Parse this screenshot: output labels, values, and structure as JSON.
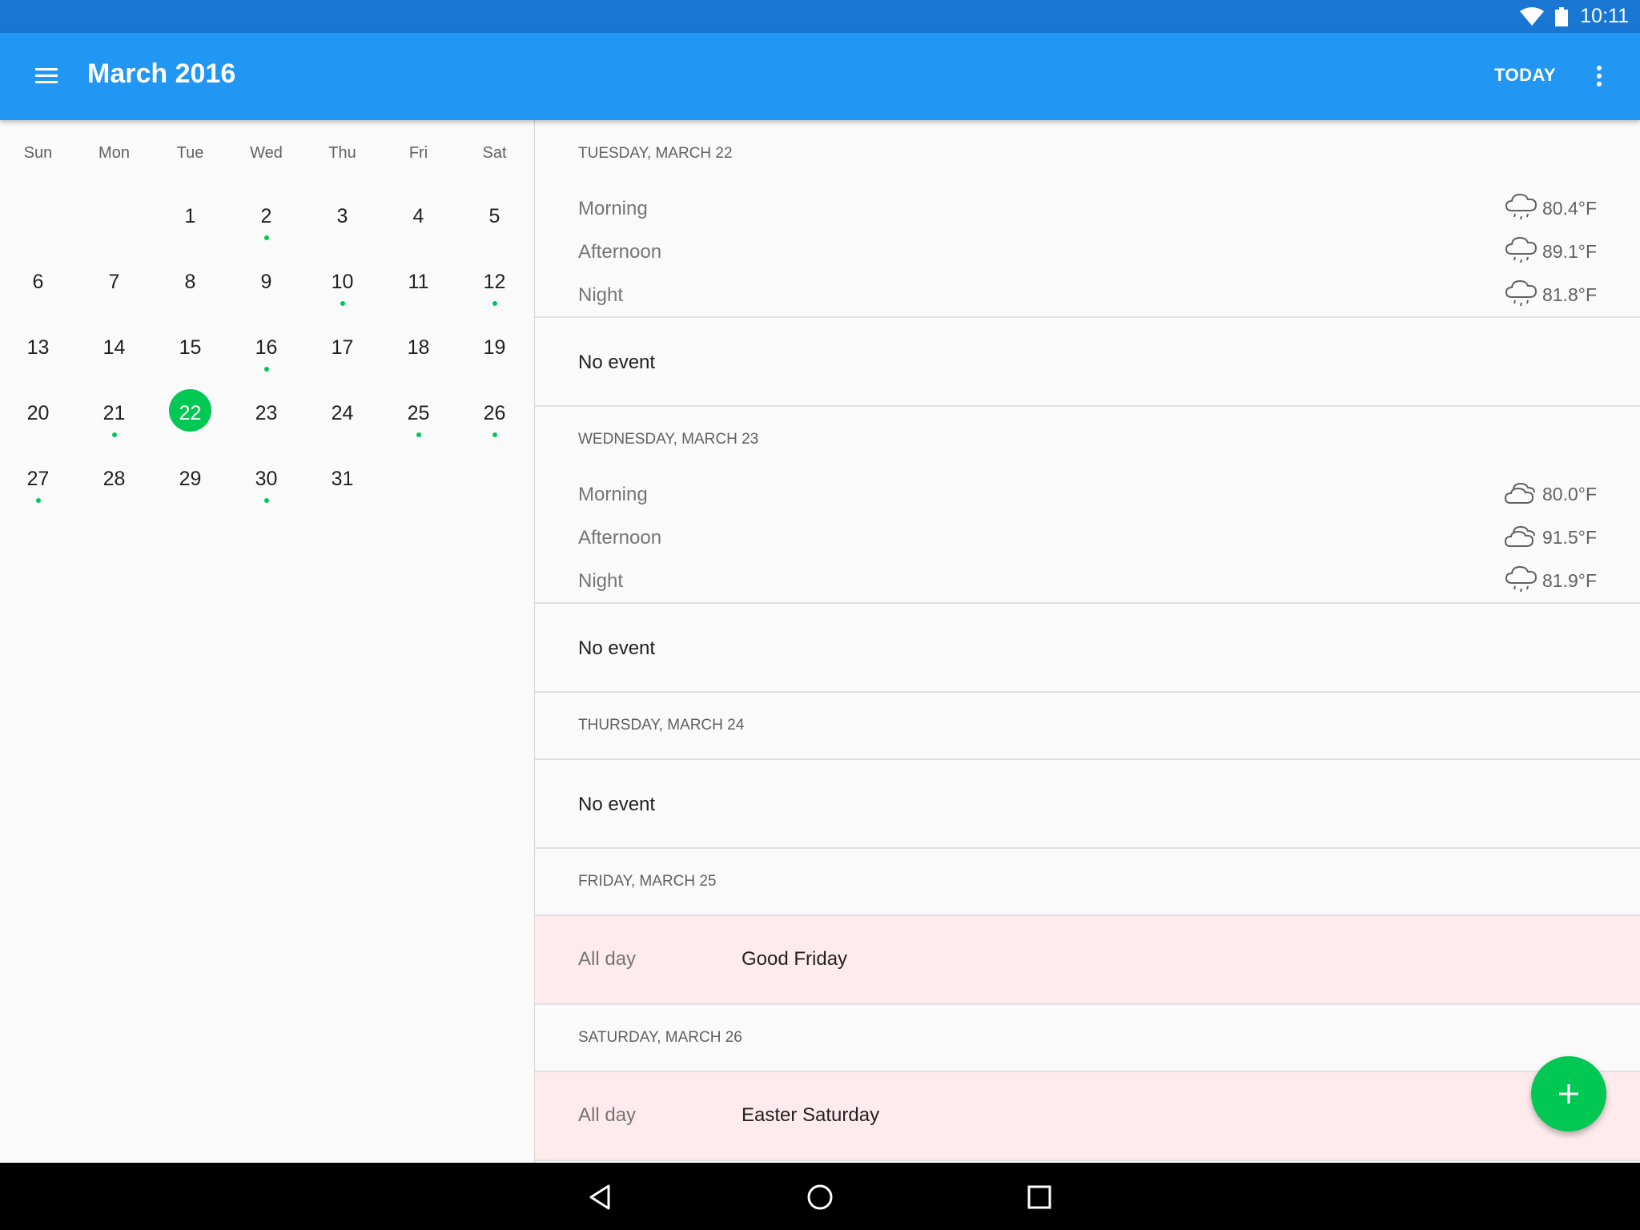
{
  "status_bar": {
    "time": "10:11",
    "wifi_icon": "wifi-icon",
    "battery_icon": "battery-icon"
  },
  "app_bar": {
    "menu_icon": "hamburger-menu-icon",
    "title": "March 2016",
    "today_label": "TODAY",
    "overflow_icon": "more-vert-icon"
  },
  "calendar": {
    "weekdays": [
      "Sun",
      "Mon",
      "Tue",
      "Wed",
      "Thu",
      "Fri",
      "Sat"
    ],
    "days": [
      "1",
      "2",
      "3",
      "4",
      "5",
      "6",
      "7",
      "8",
      "9",
      "10",
      "11",
      "12",
      "13",
      "14",
      "15",
      "16",
      "17",
      "18",
      "19",
      "20",
      "21",
      "22",
      "23",
      "24",
      "25",
      "26",
      "27",
      "28",
      "29",
      "30",
      "31"
    ],
    "selected_day": "22",
    "days_with_events": [
      "2",
      "10",
      "12",
      "16",
      "21",
      "25",
      "26",
      "27",
      "30"
    ],
    "accent_color": "#00c853"
  },
  "agenda": [
    {
      "header": "TUESDAY, MARCH 22",
      "weather": [
        {
          "label": "Morning",
          "temp": "80.4°F",
          "icon": "rain-cloud-icon"
        },
        {
          "label": "Afternoon",
          "temp": "89.1°F",
          "icon": "rain-cloud-icon"
        },
        {
          "label": "Night",
          "temp": "81.8°F",
          "icon": "rain-cloud-icon"
        }
      ],
      "event": "No event"
    },
    {
      "header": "WEDNESDAY, MARCH 23",
      "weather": [
        {
          "label": "Morning",
          "temp": "80.0°F",
          "icon": "cloudy-icon"
        },
        {
          "label": "Afternoon",
          "temp": "91.5°F",
          "icon": "cloudy-icon"
        },
        {
          "label": "Night",
          "temp": "81.9°F",
          "icon": "rain-cloud-icon"
        }
      ],
      "event": "No event"
    },
    {
      "header": "THURSDAY, MARCH 24",
      "event": "No event"
    },
    {
      "header": "FRIDAY, MARCH 25",
      "event_time": "All day",
      "event_title": "Good Friday",
      "event_color": "#ffebee"
    },
    {
      "header": "SATURDAY, MARCH 26",
      "event_time": "All day",
      "event_title": "Easter Saturday",
      "event_color": "#ffebee"
    }
  ],
  "fab": {
    "icon": "plus-icon",
    "color": "#00c853"
  },
  "nav_bar": {
    "back_icon": "back-icon",
    "home_icon": "home-icon",
    "recents_icon": "recents-icon"
  },
  "colors": {
    "status_bar": "#1976d2",
    "app_bar": "#2196f3"
  }
}
